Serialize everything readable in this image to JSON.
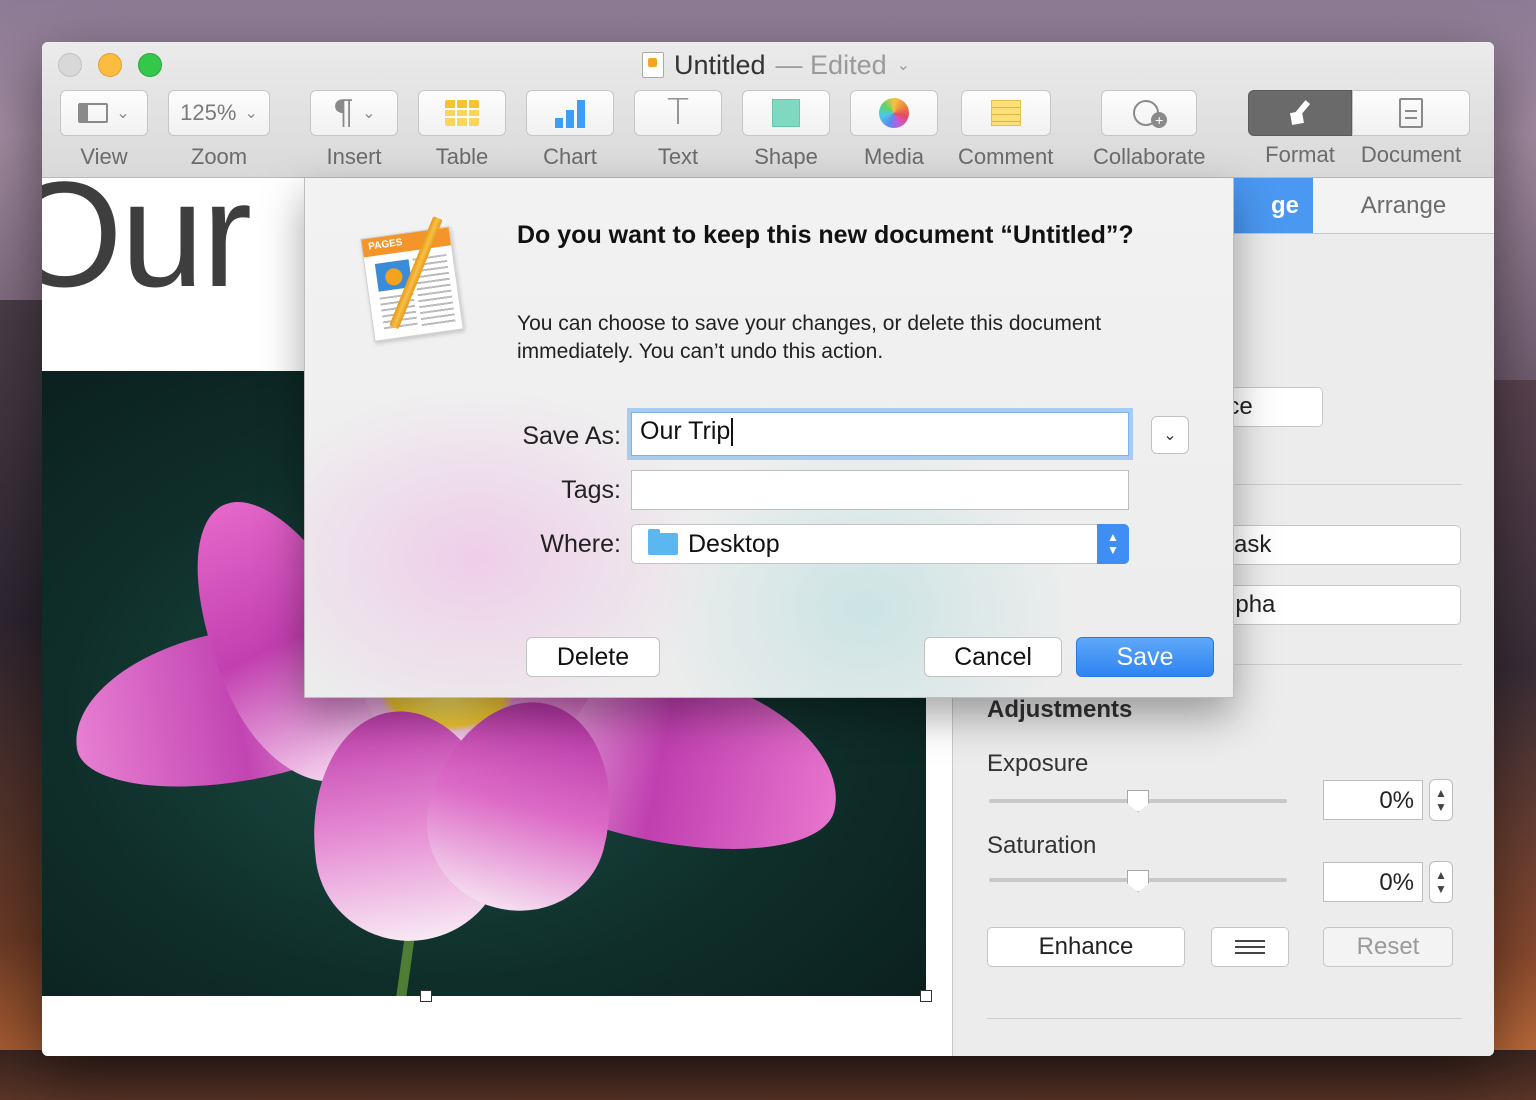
{
  "window": {
    "title": "Untitled",
    "status": "— Edited",
    "status_chevron": "⌄"
  },
  "toolbar": {
    "view_label": "View",
    "zoom_value": "125%",
    "zoom_label": "Zoom",
    "insert_label": "Insert",
    "table_label": "Table",
    "chart_label": "Chart",
    "text_label": "Text",
    "shape_label": "Shape",
    "media_label": "Media",
    "comment_label": "Comment",
    "collaborate_label": "Collaborate",
    "format_label": "Format",
    "document_label": "Document"
  },
  "canvas": {
    "heading_fragment": "Our"
  },
  "inspector": {
    "tab_active_fragment": "ge",
    "tab_arrange": "Arrange",
    "replace_fragment": "ace",
    "mask_fragment": "Mask",
    "alpha_fragment": "Alpha",
    "adjustments_heading": "Adjustments",
    "exposure_label": "Exposure",
    "exposure_value": "0%",
    "saturation_label": "Saturation",
    "saturation_value": "0%",
    "enhance_label": "Enhance",
    "reset_label": "Reset",
    "exposure_level": 0.5,
    "saturation_level": 0.5
  },
  "dialog": {
    "app_badge": "PAGES",
    "title": "Do you want to keep this new document “Untitled”?",
    "message": "You can choose to save your changes, or delete this document immediately. You can’t undo this action.",
    "save_as_label": "Save As:",
    "save_as_value": "Our Trip",
    "tags_label": "Tags:",
    "tags_value": "",
    "where_label": "Where:",
    "where_value": "Desktop",
    "delete_label": "Delete",
    "cancel_label": "Cancel",
    "save_label": "Save"
  },
  "colors": {
    "accent": "#2d84f2",
    "active_tab": "#4a98f2"
  }
}
